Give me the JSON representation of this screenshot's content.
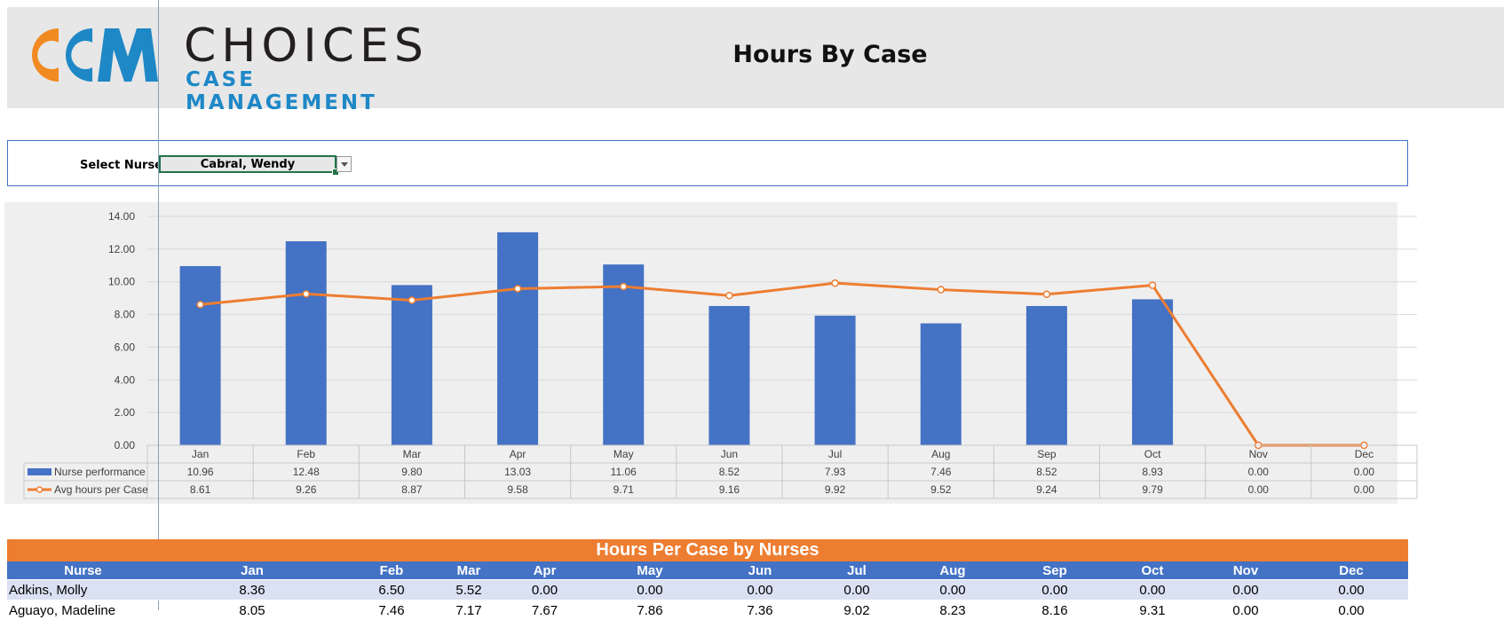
{
  "header": {
    "logo_line1": "CHOICES",
    "logo_line2": "CASE MANAGEMENT",
    "title": "Hours By Case"
  },
  "selector": {
    "label": "Select Nurse ->",
    "value": "Cabral, Wendy"
  },
  "colors": {
    "bar": "#4472c4",
    "line": "#ed7d31",
    "table_header": "#4472c4",
    "table_title": "#ed7d31",
    "row_band": "#d9e1f2"
  },
  "chart_data": {
    "type": "bar",
    "categories": [
      "Jan",
      "Feb",
      "Mar",
      "Apr",
      "May",
      "Jun",
      "Jul",
      "Aug",
      "Sep",
      "Oct",
      "Nov",
      "Dec"
    ],
    "series": [
      {
        "name": "Nurse performance",
        "type": "bar",
        "values": [
          10.96,
          12.48,
          9.8,
          13.03,
          11.06,
          8.52,
          7.93,
          7.46,
          8.52,
          8.93,
          0.0,
          0.0
        ]
      },
      {
        "name": "Avg hours per Case",
        "type": "line",
        "values": [
          8.61,
          9.26,
          8.87,
          9.58,
          9.71,
          9.16,
          9.92,
          9.52,
          9.24,
          9.79,
          0.0,
          0.0
        ]
      }
    ],
    "yticks": [
      "0.00",
      "2.00",
      "4.00",
      "6.00",
      "8.00",
      "10.00",
      "12.00",
      "14.00"
    ],
    "ylim": [
      0,
      14
    ],
    "grid": true,
    "data_table": true
  },
  "table": {
    "title": "Hours Per Case by Nurses",
    "headers": [
      "Nurse",
      "Jan",
      "Feb",
      "Mar",
      "Apr",
      "May",
      "Jun",
      "Jul",
      "Aug",
      "Sep",
      "Oct",
      "Nov",
      "Dec"
    ],
    "rows": [
      [
        "Adkins, Molly",
        "8.36",
        "6.50",
        "5.52",
        "0.00",
        "0.00",
        "0.00",
        "0.00",
        "0.00",
        "0.00",
        "0.00",
        "0.00",
        "0.00"
      ],
      [
        "Aguayo, Madeline",
        "8.05",
        "7.46",
        "7.17",
        "7.67",
        "7.86",
        "7.36",
        "9.02",
        "8.23",
        "8.16",
        "9.31",
        "0.00",
        "0.00"
      ]
    ]
  }
}
